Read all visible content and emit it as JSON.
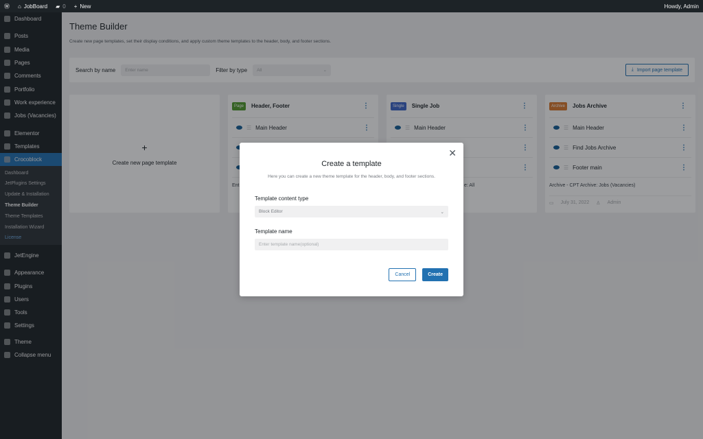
{
  "adminbar": {
    "site": "JobBoard",
    "comments": "0",
    "new": "New",
    "howdy": "Howdy, Admin"
  },
  "sidebar": {
    "items": [
      {
        "label": "Dashboard"
      },
      {
        "label": "Posts"
      },
      {
        "label": "Media"
      },
      {
        "label": "Pages"
      },
      {
        "label": "Comments"
      },
      {
        "label": "Portfolio"
      },
      {
        "label": "Work experience"
      },
      {
        "label": "Jobs (Vacancies)"
      },
      {
        "label": "Elementor"
      },
      {
        "label": "Templates"
      },
      {
        "label": "Crocoblock"
      }
    ],
    "submenu": [
      "Dashboard",
      "JetPlugins Settings",
      "Update & Installation",
      "Theme Builder",
      "Theme Templates",
      "Installation Wizard",
      "License"
    ],
    "items2": [
      {
        "label": "JetEngine"
      },
      {
        "label": "Appearance"
      },
      {
        "label": "Plugins"
      },
      {
        "label": "Users"
      },
      {
        "label": "Tools"
      },
      {
        "label": "Settings"
      },
      {
        "label": "Theme"
      },
      {
        "label": "Collapse menu"
      }
    ]
  },
  "page": {
    "title": "Theme Builder",
    "description": "Create new page templates, set their display conditions, and apply custom theme templates to the header, body, and footer sections.",
    "search_label": "Search by name",
    "search_placeholder": "Enter name",
    "filter_label": "Filter by type",
    "filter_value": "All",
    "import_label": "Import page template",
    "new_template": "Create new page template"
  },
  "cards": [
    {
      "badge": "Page",
      "badge_color": "#4e9a2b",
      "title": "Header, Footer",
      "rows": [
        "Main Header",
        "",
        ""
      ],
      "condition": "Ent"
    },
    {
      "badge": "Single",
      "badge_color": "#3b64c9",
      "title": "Single Job",
      "rows": [
        "Main Header",
        "",
        ""
      ],
      "condition": "e: All"
    },
    {
      "badge": "Archive",
      "badge_color": "#d9782b",
      "title": "Jobs Archive",
      "rows": [
        "Main Header",
        "Find Jobs Archive",
        "Footer main"
      ],
      "condition": "Archive - CPT Archive: Jobs (Vacancies)",
      "date": "July 31, 2022",
      "author": "Admin"
    }
  ],
  "modal": {
    "title": "Create a template",
    "subtitle": "Here you can create a new theme template for the header, body, and footer sections.",
    "type_label": "Template content type",
    "type_value": "Block Editor",
    "name_label": "Template name",
    "name_placeholder": "Enter template name(optional)",
    "cancel": "Cancel",
    "create": "Create"
  }
}
